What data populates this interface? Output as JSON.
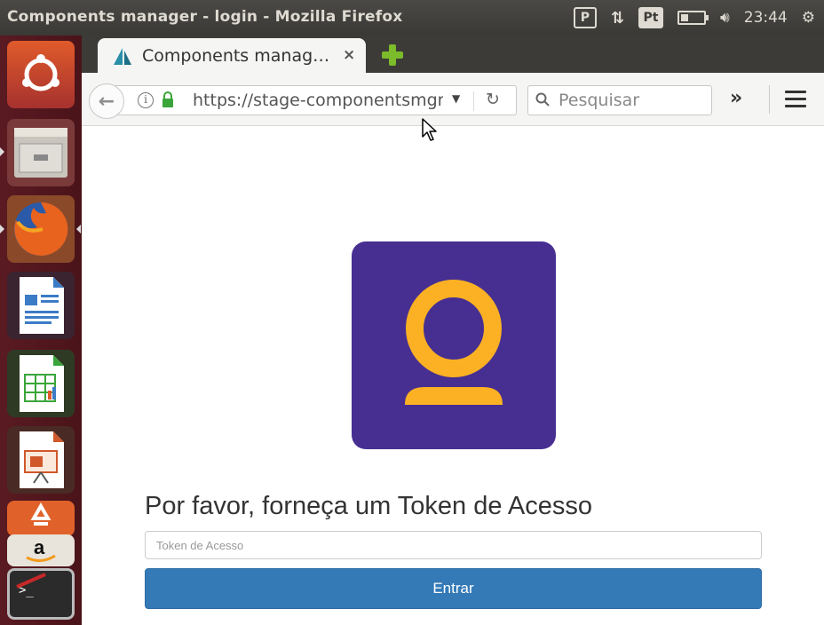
{
  "window": {
    "title": "Components manager - login - Mozilla Firefox"
  },
  "panel": {
    "time": "23:44",
    "keyboard_layout": "Pt"
  },
  "launcher": {
    "items": [
      {
        "name": "Ubuntu Dash",
        "icon": "ubuntu-logo-icon"
      },
      {
        "name": "Files",
        "icon": "file-cabinet-icon"
      },
      {
        "name": "Firefox",
        "icon": "firefox-icon"
      },
      {
        "name": "LibreOffice Writer",
        "icon": "writer-document-icon"
      },
      {
        "name": "LibreOffice Calc",
        "icon": "calc-spreadsheet-icon"
      },
      {
        "name": "LibreOffice Impress",
        "icon": "impress-presentation-icon"
      },
      {
        "name": "Ubuntu Software",
        "icon": "shopping-bag-icon"
      },
      {
        "name": "Amazon",
        "icon": "amazon-icon"
      },
      {
        "name": "Terminal",
        "icon": "terminal-icon"
      }
    ]
  },
  "browser": {
    "tab": {
      "title": "Components manag…",
      "close": "×"
    },
    "url": "https://stage-componentsmgr",
    "search_placeholder": "Pesquisar",
    "overflow": "»"
  },
  "page": {
    "heading": "Por favor, forneça um Token de Acesso",
    "input_placeholder": "Token de Acesso",
    "submit_label": "Entrar",
    "colors": {
      "logo_bg": "#472f92",
      "logo_fg": "#fbb123",
      "button": "#337ab7"
    }
  }
}
